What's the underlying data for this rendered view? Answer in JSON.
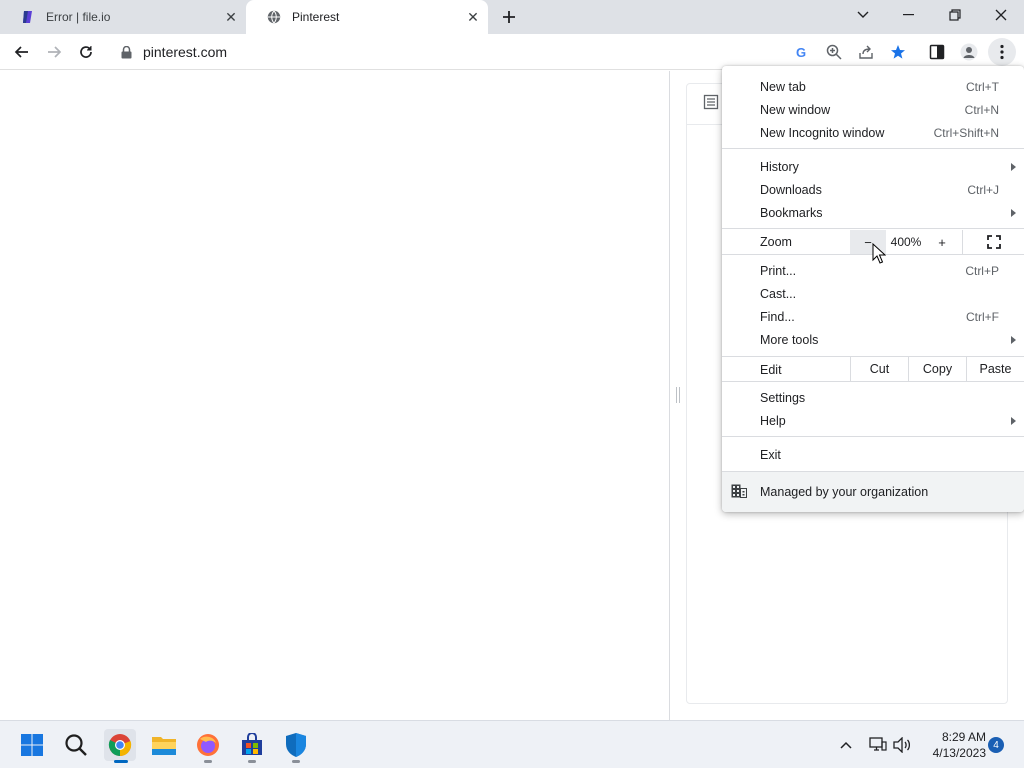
{
  "browser": {
    "tabs": [
      {
        "title": "Error | file.io",
        "active": false
      },
      {
        "title": "Pinterest",
        "active": true
      }
    ],
    "url": "pinterest.com"
  },
  "menu": {
    "items": [
      {
        "label": "New tab",
        "shortcut": "Ctrl+T"
      },
      {
        "label": "New window",
        "shortcut": "Ctrl+N"
      },
      {
        "label": "New Incognito window",
        "shortcut": "Ctrl+Shift+N"
      },
      {
        "label": "History",
        "submenu": true
      },
      {
        "label": "Downloads",
        "shortcut": "Ctrl+J"
      },
      {
        "label": "Bookmarks",
        "submenu": true
      },
      {
        "label": "Print...",
        "shortcut": "Ctrl+P"
      },
      {
        "label": "Cast..."
      },
      {
        "label": "Find...",
        "shortcut": "Ctrl+F"
      },
      {
        "label": "More tools",
        "submenu": true
      },
      {
        "label": "Settings"
      },
      {
        "label": "Help",
        "submenu": true
      },
      {
        "label": "Exit"
      }
    ],
    "zoom": {
      "label": "Zoom",
      "minus": "−",
      "value": "400%",
      "plus": "+"
    },
    "edit": {
      "label": "Edit",
      "cut": "Cut",
      "copy": "Copy",
      "paste": "Paste"
    },
    "managed": "Managed by your organization"
  },
  "taskbar": {
    "time": "8:29 AM",
    "date": "4/13/2023",
    "notifications": "4"
  },
  "colors": {
    "tabstrip": "#dee1e6",
    "accent": "#1a73e8",
    "star": "#1a73e8"
  }
}
